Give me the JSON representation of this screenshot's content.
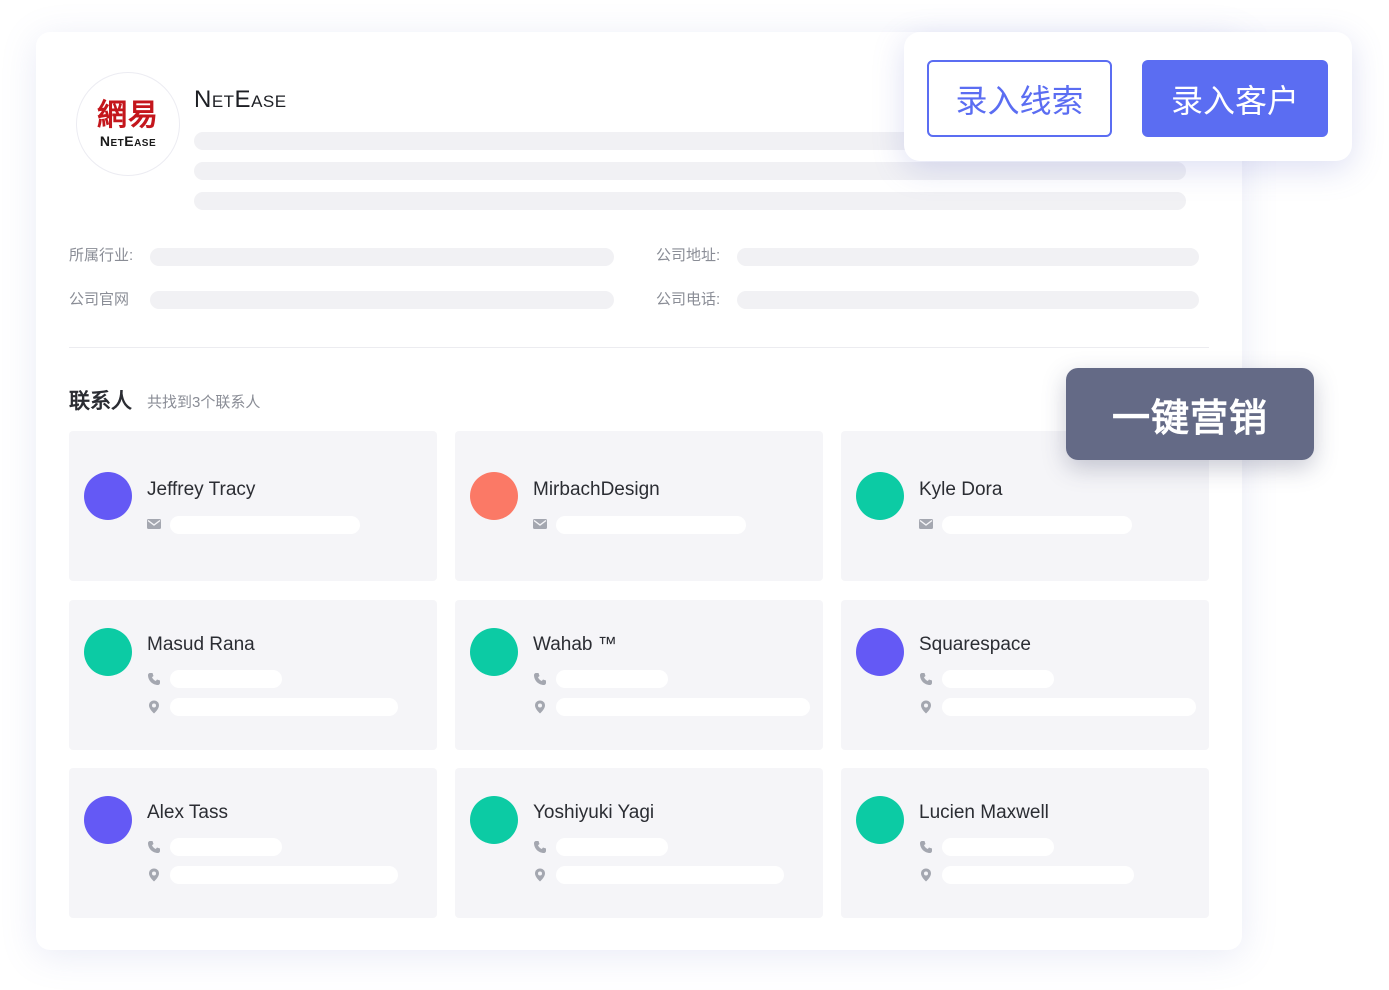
{
  "company": {
    "logo_mark": "網易",
    "logo_text": "NetEase",
    "name": "NetEase"
  },
  "info": {
    "industry_label": "所属行业:",
    "address_label": "公司地址:",
    "website_label": "公司官网",
    "phone_label": "公司电话:"
  },
  "contacts_section": {
    "title": "联系人",
    "subtitle": "共找到3个联系人"
  },
  "actions": {
    "enter_lead": "录入线索",
    "enter_customer": "录入客户",
    "one_click_marketing": "一键营销"
  },
  "colors": {
    "accent": "#5b6df2",
    "avatar_purple": "#6459f5",
    "avatar_coral": "#fb7966",
    "avatar_teal": "#0ccba4",
    "marketing_button": "#646a86"
  },
  "contacts": [
    {
      "name": "Jeffrey Tracy",
      "avatar_color": "#6459f5",
      "fields": [
        "mail-icon"
      ]
    },
    {
      "name": "MirbachDesign",
      "avatar_color": "#fb7966",
      "fields": [
        "mail-icon"
      ]
    },
    {
      "name": "Kyle Dora",
      "avatar_color": "#0ccba4",
      "fields": [
        "mail-icon"
      ]
    },
    {
      "name": "Masud Rana",
      "avatar_color": "#0ccba4",
      "fields": [
        "phone-icon",
        "location-icon"
      ]
    },
    {
      "name": "Wahab ™",
      "avatar_color": "#0ccba4",
      "fields": [
        "phone-icon",
        "location-icon"
      ]
    },
    {
      "name": "Squarespace",
      "avatar_color": "#6459f5",
      "fields": [
        "phone-icon",
        "location-icon"
      ]
    },
    {
      "name": "Alex Tass",
      "avatar_color": "#6459f5",
      "fields": [
        "phone-icon",
        "location-icon"
      ]
    },
    {
      "name": "Yoshiyuki Yagi",
      "avatar_color": "#0ccba4",
      "fields": [
        "phone-icon",
        "location-icon"
      ]
    },
    {
      "name": "Lucien Maxwell",
      "avatar_color": "#0ccba4",
      "fields": [
        "phone-icon",
        "location-icon"
      ]
    }
  ]
}
